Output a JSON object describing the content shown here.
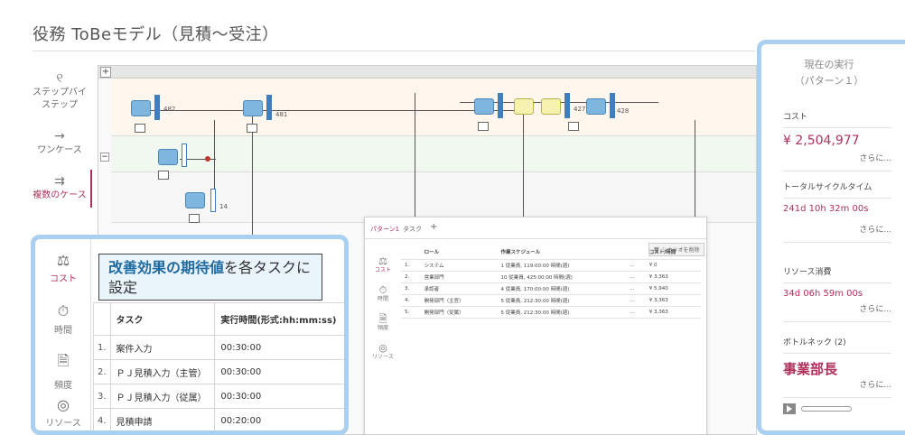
{
  "page": {
    "title": "役務 ToBeモデル（見積～受注）"
  },
  "mode_menu": [
    {
      "icon": "step-by-step-icon",
      "glyph": "୧",
      "label": "ステップバイステップ"
    },
    {
      "icon": "arrow-right-icon",
      "glyph": "→",
      "label": "ワンケース"
    },
    {
      "icon": "double-arrow-icon",
      "glyph": "⇉",
      "label": "複数のケース"
    }
  ],
  "diagram": {
    "labels": [
      "482",
      "481",
      "14",
      "427",
      "428"
    ]
  },
  "inner_panel": {
    "tabs": [
      "パターン1",
      "タスク",
      "+"
    ],
    "side_items": [
      {
        "glyph": "⚖",
        "label": "コスト"
      },
      {
        "glyph": "⏱",
        "label": "時間"
      },
      {
        "glyph": "🗎",
        "label": "頻度"
      },
      {
        "glyph": "◎",
        "label": "リソース"
      }
    ],
    "remove_button": "シナリオを削除",
    "columns": [
      "",
      "ロール",
      "作業スケジュール",
      "",
      "コスト/時間"
    ],
    "rows": [
      [
        "1.",
        "システム",
        "1 従業員, 119:00:00 時間(週)",
        "...",
        "¥ 0"
      ],
      [
        "2.",
        "営業部門",
        "10 従業員, 425:00:00 時間(週)",
        "...",
        "¥ 3,363"
      ],
      [
        "3.",
        "承認者",
        "4 従業員, 170:00:00 時間(週)",
        "...",
        "¥ 5,940"
      ],
      [
        "4.",
        "開発部門（主官）",
        "5 従業員, 212:30:00 時間(週)",
        "...",
        "¥ 3,363"
      ],
      [
        "5.",
        "開発部門（従属）",
        "5 従業員, 212:30:00 時間(週)",
        "...",
        "¥ 3,363"
      ]
    ]
  },
  "left_callout": {
    "side_items": [
      {
        "glyph": "⚖",
        "label": "コスト",
        "active": true
      },
      {
        "glyph": "⏱",
        "label": "時間",
        "active": false
      },
      {
        "glyph": "🗎",
        "label": "頻度",
        "active": false
      },
      {
        "glyph": "◎",
        "label": "リソース",
        "active": false
      }
    ],
    "title_bold": "改善効果の期待値",
    "title_rest": "を各タスクに設定",
    "columns": [
      "",
      "タスク",
      "実行時間(形式:hh:mm:ss)"
    ],
    "rows": [
      [
        "1.",
        "案件入力",
        "00:30:00"
      ],
      [
        "2.",
        "ＰＪ見積入力（主管）",
        "00:30:00"
      ],
      [
        "3.",
        "ＰＪ見積入力（従属）",
        "00:30:00"
      ],
      [
        "4.",
        "見積申請",
        "00:20:00"
      ]
    ]
  },
  "right_callout": {
    "header_line1": "現在の実行",
    "header_line2": "（パターン１）",
    "sections": [
      {
        "label": "コスト",
        "value": "¥ 2,504,977",
        "more": "さらに..."
      },
      {
        "label": "トータルサイクルタイム",
        "value": "241d 10h 32m 00s",
        "more": "さらに..."
      },
      {
        "label": "リソース消費",
        "value": "34d 06h 59m 00s",
        "more": "さらに..."
      },
      {
        "label": "ボトルネック (2)",
        "value": "事業部長",
        "more": "さらに..."
      }
    ]
  },
  "colors": {
    "accent": "#b0305a",
    "callout_border": "#a9d0f1",
    "title_box_bg": "#eaf4fb"
  }
}
